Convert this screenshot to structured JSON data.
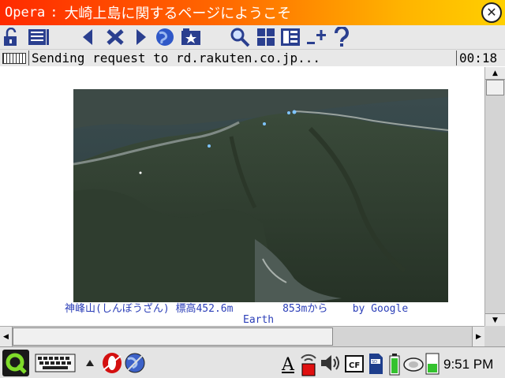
{
  "window": {
    "app_name": "Opera",
    "separator": ":",
    "title": "大崎上島に関するページにようこそ"
  },
  "toolbar": {
    "icons": [
      "lock-icon",
      "menu-icon",
      "back-icon",
      "stop-icon",
      "forward-icon",
      "globe-icon",
      "bookmarks-icon",
      "search-icon",
      "windows-icon",
      "panels-icon",
      "zoom-icon",
      "help-icon"
    ]
  },
  "status": {
    "message": "Sending request to rd.rakuten.co.jp...",
    "elapsed": "00:18"
  },
  "content": {
    "caption_line1_name": "神峰山(しんぼうざん) 標高452.6m",
    "caption_line1_distance": "853mから",
    "caption_line1_credit": "by Google",
    "caption_line2": "Earth"
  },
  "taskbar": {
    "ime_indicator": "A",
    "clock": "9:51 PM"
  },
  "colors": {
    "title_gradient_start": "#ff2a00",
    "title_gradient_end": "#ffd000",
    "caption_link": "#2c3fb8",
    "toolbar_icon": "#2a3f8f"
  }
}
